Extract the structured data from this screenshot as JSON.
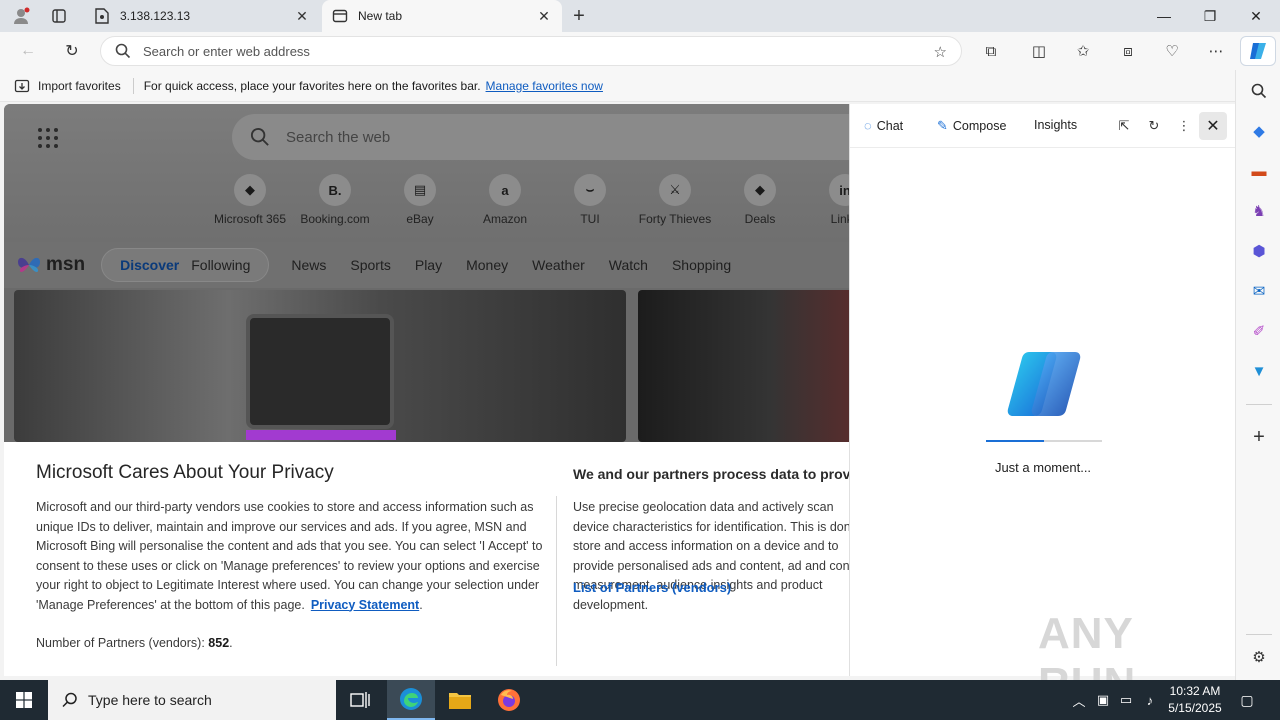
{
  "browser": {
    "tabs": [
      {
        "title": "3.138.123.13",
        "active": false
      },
      {
        "title": "New tab",
        "active": true
      }
    ],
    "new_tab_icon": "plus-icon",
    "address_placeholder": "Search or enter web address"
  },
  "favorites_bar": {
    "import_label": "Import favorites",
    "hint": "For quick access, place your favorites here on the favorites bar.",
    "manage_link": "Manage favorites now"
  },
  "new_tab_page": {
    "search_placeholder": "Search the web",
    "quick_links": [
      {
        "label": "Microsoft 365",
        "glyph": "◆"
      },
      {
        "label": "Booking.com",
        "glyph": "B."
      },
      {
        "label": "eBay",
        "glyph": "▤"
      },
      {
        "label": "Amazon",
        "glyph": "a"
      },
      {
        "label": "TUI",
        "glyph": "⌣"
      },
      {
        "label": "Forty Thieves",
        "glyph": "⚔"
      },
      {
        "label": "Deals",
        "glyph": "◆"
      },
      {
        "label": "Linke",
        "glyph": "in"
      }
    ],
    "msn": {
      "logo_text": "msn",
      "feed_tabs": [
        "Discover",
        "Following"
      ],
      "selected_feed_tab": "Discover",
      "nav": [
        "News",
        "Sports",
        "Play",
        "Money",
        "Weather",
        "Watch",
        "Shopping"
      ]
    }
  },
  "privacy_dialog": {
    "title": "Microsoft Cares About Your Privacy",
    "body": "Microsoft and our third-party vendors use cookies to store and access information such as unique IDs to deliver, maintain and improve our services and ads. If you agree, MSN and Microsoft Bing will personalise the content and ads that you see. You can select 'I Accept' to consent to these uses or click on 'Manage preferences' to review your options and exercise your right to object to Legitimate Interest where used.  You can change your selection under 'Manage Preferences' at the bottom of this page.",
    "privacy_link": "Privacy Statement",
    "partners_label": "Number of Partners (vendors):",
    "partners_count": "852",
    "right_title": "We and our partners process data to provide:",
    "right_body": "Use precise geolocation data and actively scan device characteristics for identification. This is done to store and access information on a device and to provide personalised ads and content, ad and content measurement, audience insights and product development.",
    "vendors_link": "List of Partners (vendors)"
  },
  "copilot": {
    "tabs": [
      "Chat",
      "Compose",
      "Insights"
    ],
    "status_text": "Just a moment...",
    "loading_progress": 0.5
  },
  "watermark": "ANY RUN",
  "taskbar": {
    "search_placeholder": "Type here to search",
    "time": "10:32 AM",
    "date": "5/15/2025"
  },
  "colors": {
    "accent": "#1a6fd6",
    "link": "#0f5cc0",
    "taskbar": "#1f2a33"
  }
}
